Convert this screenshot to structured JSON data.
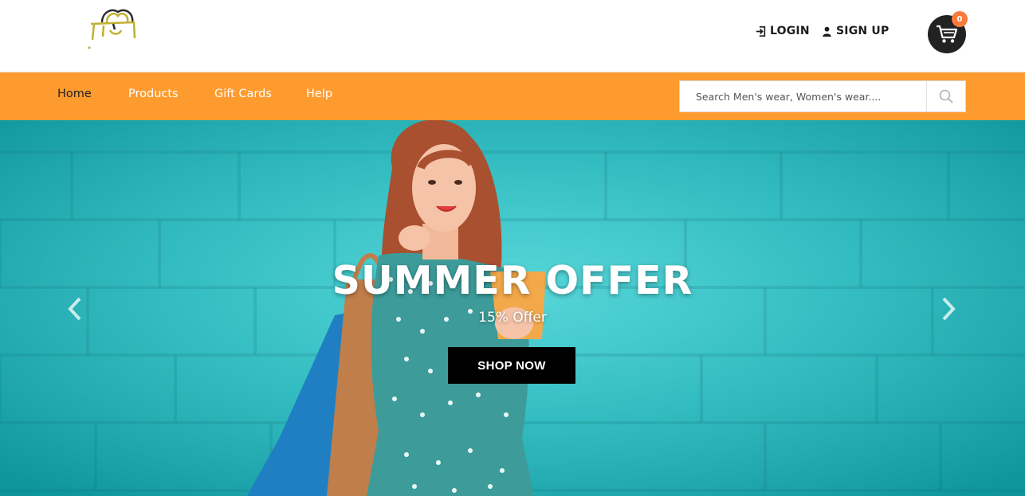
{
  "header": {
    "login_label": "LOGIN",
    "signup_label": "SIGN UP",
    "cart_count": "0",
    "logo_icon": "shopping-bag-logo"
  },
  "nav": {
    "items": [
      {
        "label": "Home",
        "active": true
      },
      {
        "label": "Products",
        "active": false
      },
      {
        "label": "Gift Cards",
        "active": false
      },
      {
        "label": "Help",
        "active": false
      }
    ],
    "search_placeholder": "Search Men's wear, Women's wear...."
  },
  "hero": {
    "title": "SUMMER OFFER",
    "subtitle": "15% Offer",
    "cta_label": "SHOP NOW",
    "prev_icon": "chevron-left-icon",
    "next_icon": "chevron-right-icon"
  },
  "colors": {
    "nav_bg": "#fe9b2e",
    "hero_bg": "#21bfc4",
    "cart_bg": "#222222",
    "badge_bg": "#f97b3b",
    "cta_bg": "#000000",
    "logo": "#c0b031"
  }
}
